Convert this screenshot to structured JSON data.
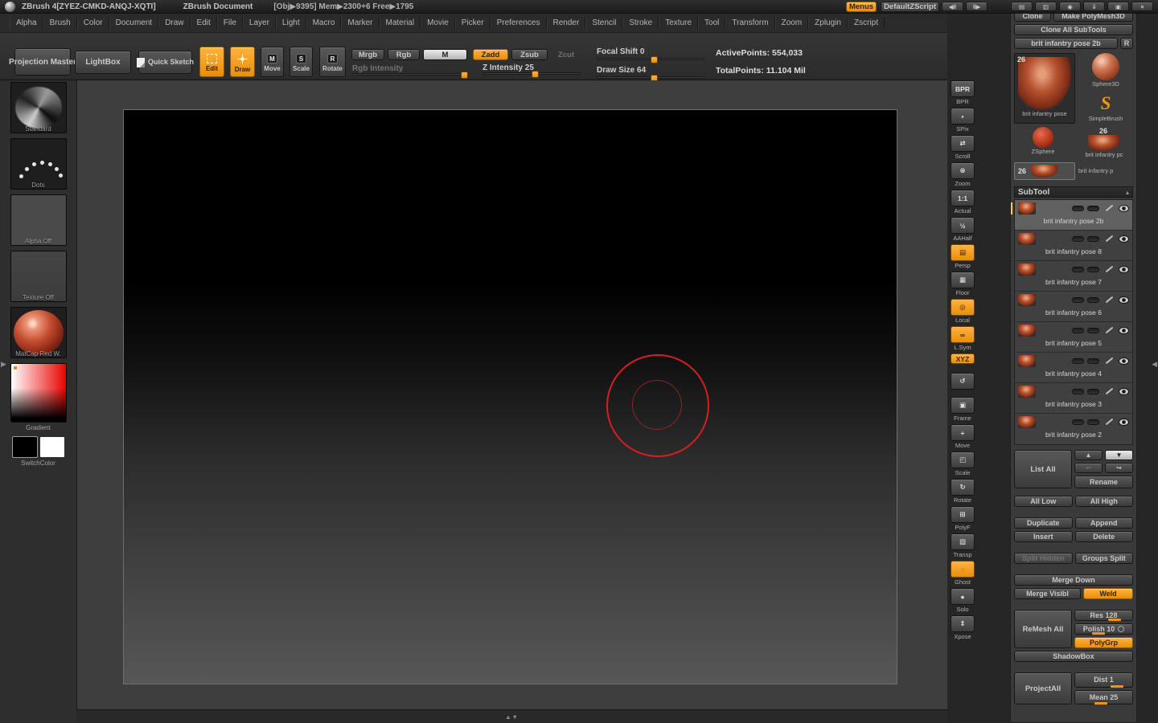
{
  "colors": {
    "accent": "#ee9612",
    "cursor_red": "#d81f1f"
  },
  "titlebar": {
    "app_title": "ZBrush 4[ZYEZ-CMKD-ANQJ-XQTI]",
    "doc_title": "ZBrush Document",
    "stats": "[Obj▶9395]  Mem▶2300+6  Free▶1795",
    "menus_button": "Menus",
    "zscript_button": "DefaultZScript",
    "icons": {
      "scroll_left": "◀‖",
      "scroll_right": "‖▶",
      "cascade": "▤",
      "store": "▥",
      "lock": "◉",
      "load": "⇓",
      "restore": "▣",
      "close": "×"
    }
  },
  "menubar": {
    "items": [
      "Alpha",
      "Brush",
      "Color",
      "Document",
      "Draw",
      "Edit",
      "File",
      "Layer",
      "Light",
      "Macro",
      "Marker",
      "Material",
      "Movie",
      "Picker",
      "Preferences",
      "Render",
      "Stencil",
      "Stroke",
      "Texture",
      "Tool",
      "Transform",
      "Zoom",
      "Zplugin",
      "Zscript"
    ]
  },
  "shelf": {
    "projection_master": "Projection Master",
    "lightbox": "LightBox",
    "quick_sketch": "Quick Sketch",
    "edit": "Edit",
    "draw": "Draw",
    "move": "Move",
    "scale": "Scale",
    "rotate": "Rotate",
    "move_icon": "M",
    "scale_icon": "S",
    "rotate_icon": "R",
    "mrgb": "Mrgb",
    "rgb": "Rgb",
    "m": "M",
    "zadd": "Zadd",
    "zsub": "Zsub",
    "zcut": "Zcut",
    "rgb_intensity": "Rgb Intensity",
    "z_intensity": "Z Intensity 25",
    "focal_shift": "Focal Shift 0",
    "draw_size": "Draw Size 64",
    "active_points": "ActivePoints: 554,033",
    "total_points": "TotalPoints: 11.104 Mil"
  },
  "left_sidebar": {
    "brush": "Standard",
    "stroke": "Dots",
    "alpha": "Alpha Off",
    "texture": "Texture Off",
    "material": "MatCap Red W.",
    "gradient": "Gradient",
    "switch_color": "SwitchColor"
  },
  "canvas": {
    "scroll_hint": "▲▼",
    "left_expander": "▶",
    "right_expander": "◀"
  },
  "right_shelf": {
    "items": [
      {
        "glyph": "BPR",
        "label": "BPR"
      },
      {
        "glyph": "▪",
        "label": "SPix"
      },
      {
        "glyph": "⇄",
        "label": "Scroll"
      },
      {
        "glyph": "⊕",
        "label": "Zoom"
      },
      {
        "glyph": "1:1",
        "label": "Actual"
      },
      {
        "glyph": "½",
        "label": "AAHalf"
      },
      {
        "glyph": "▤",
        "label": "Persp"
      },
      {
        "glyph": "▦",
        "label": "Floor"
      },
      {
        "glyph": "◎",
        "label": "Local"
      },
      {
        "glyph": "∞",
        "label": "L.Sym"
      },
      {
        "glyph": "XYZ",
        "label": ""
      },
      {
        "glyph": "↺",
        "label": ""
      },
      {
        "glyph": "▣",
        "label": "Frame"
      },
      {
        "glyph": "+",
        "label": "Move"
      },
      {
        "glyph": "◰",
        "label": "Scale"
      },
      {
        "glyph": "↻",
        "label": "Rotate"
      },
      {
        "glyph": "⊞",
        "label": "PolyF"
      },
      {
        "glyph": "▨",
        "label": "Transp"
      },
      {
        "glyph": "◌",
        "label": "Ghost"
      },
      {
        "glyph": "●",
        "label": "Solo"
      },
      {
        "glyph": "⇕",
        "label": "Xpose"
      }
    ]
  },
  "tool_panel": {
    "clone": "Clone",
    "make_polymesh": "Make PolyMesh3D",
    "clone_all": "Clone All SubTools",
    "active_tool": "brit infantry pose 2b",
    "r_button": "R",
    "thumbs": {
      "badge": "26",
      "active_label": "brit infantry pose",
      "sphere3d_label": "Sphere3D",
      "simplebrush_glyph": "S",
      "simplebrush_label": "SimpleBrush",
      "zsphere_label": "ZSphere",
      "slot2_badge": "26",
      "slot2_label": "brit infantry pc",
      "slot3_badge": "26",
      "slot3_label": "brit infantry p"
    }
  },
  "subtool": {
    "header": "SubTool",
    "header_icon": "▴",
    "rows": [
      {
        "label": "brit infantry pose 2b"
      },
      {
        "label": "brit infantry pose 8"
      },
      {
        "label": "brit infantry pose 7"
      },
      {
        "label": "brit infantry pose 6"
      },
      {
        "label": "brit infantry pose 5"
      },
      {
        "label": "brit infantry pose 4"
      },
      {
        "label": "brit infantry pose 3"
      },
      {
        "label": "brit infantry pose 2"
      }
    ],
    "list_all": "List All",
    "arrow_up": "▲",
    "arrow_down": "▼",
    "arrow_left": "↩",
    "arrow_right": "↪",
    "rename": "Rename",
    "all_low": "All Low",
    "all_high": "All High",
    "duplicate": "Duplicate",
    "append": "Append",
    "insert": "Insert",
    "delete": "Delete",
    "split_hidden": "Split Hidden",
    "groups_split": "Groups Split",
    "merge_down": "Merge Down",
    "merge_visible": "Merge Visibl",
    "weld": "Weld",
    "remesh_all": "ReMesh All",
    "res": "Res 128",
    "polish": "Polish 10",
    "polygrp": "PolyGrp",
    "shadowbox": "ShadowBox",
    "project_all": "ProjectAll",
    "dist": "Dist 1",
    "mean": "Mean 25"
  }
}
